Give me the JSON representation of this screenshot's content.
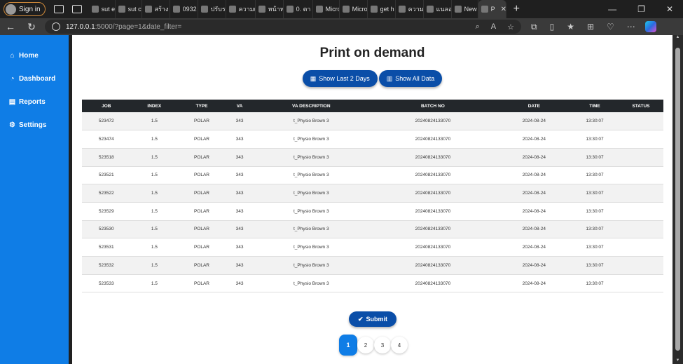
{
  "browser": {
    "signin_label": "Sign in",
    "tabs": [
      {
        "label": "sut e"
      },
      {
        "label": "sut cv"
      },
      {
        "label": "สร้าง"
      },
      {
        "label": "0932"
      },
      {
        "label": "ปรับรา"
      },
      {
        "label": "ความเ"
      },
      {
        "label": "หน้าห"
      },
      {
        "label": "0. ตา"
      },
      {
        "label": "Micro"
      },
      {
        "label": "Micro"
      },
      {
        "label": "get h"
      },
      {
        "label": "ความเ"
      },
      {
        "label": "แนลอ"
      },
      {
        "label": "New"
      },
      {
        "label": "P"
      }
    ],
    "url_host": "127.0.0.1",
    "url_path": ":5000/?page=1&date_filter="
  },
  "sidebar": {
    "items": [
      {
        "label": "Home",
        "icon": "home-icon"
      },
      {
        "label": "Dashboard",
        "icon": "dashboard-icon"
      },
      {
        "label": "Reports",
        "icon": "file-icon"
      },
      {
        "label": "Settings",
        "icon": "gear-icon"
      }
    ]
  },
  "main": {
    "title": "Print on demand",
    "filter_last2": "Show Last 2 Days",
    "filter_all": "Show All Data",
    "submit_label": "Submit"
  },
  "table": {
    "headers": [
      "JOB",
      "INDEX",
      "TYPE",
      "VA",
      "VA DESCRIPTION",
      "BATCH NO",
      "DATE",
      "TIME",
      "STATUS"
    ],
    "rows": [
      [
        "523472",
        "1.5",
        "POLAR",
        "343",
        "t_Physio Brown 3",
        "20240824133070",
        "2024-08-24",
        "13:30:07",
        ""
      ],
      [
        "523474",
        "1.5",
        "POLAR",
        "343",
        "t_Physio Brown 3",
        "20240824133070",
        "2024-08-24",
        "13:30:07",
        ""
      ],
      [
        "523518",
        "1.5",
        "POLAR",
        "343",
        "t_Physio Brown 3",
        "20240824133070",
        "2024-08-24",
        "13:30:07",
        ""
      ],
      [
        "523521",
        "1.5",
        "POLAR",
        "343",
        "t_Physio Brown 3",
        "20240824133070",
        "2024-08-24",
        "13:30:07",
        ""
      ],
      [
        "523522",
        "1.5",
        "POLAR",
        "343",
        "t_Physio Brown 3",
        "20240824133070",
        "2024-08-24",
        "13:30:07",
        ""
      ],
      [
        "523529",
        "1.5",
        "POLAR",
        "343",
        "t_Physio Brown 3",
        "20240824133070",
        "2024-08-24",
        "13:30:07",
        ""
      ],
      [
        "523530",
        "1.5",
        "POLAR",
        "343",
        "t_Physio Brown 3",
        "20240824133070",
        "2024-08-24",
        "13:30:07",
        ""
      ],
      [
        "523531",
        "1.5",
        "POLAR",
        "343",
        "t_Physio Brown 3",
        "20240824133070",
        "2024-08-24",
        "13:30:07",
        ""
      ],
      [
        "523532",
        "1.5",
        "POLAR",
        "343",
        "t_Physio Brown 3",
        "20240824133070",
        "2024-08-24",
        "13:30:07",
        ""
      ],
      [
        "523533",
        "1.5",
        "POLAR",
        "343",
        "t_Physio Brown 3",
        "20240824133070",
        "2024-08-24",
        "13:30:07",
        ""
      ]
    ]
  },
  "pagination": {
    "pages": [
      "1",
      "2",
      "3",
      "4"
    ],
    "current": "1"
  },
  "colors": {
    "sidebar": "#0f7de6",
    "button": "#0a4ea8",
    "table_header": "#23272b"
  }
}
